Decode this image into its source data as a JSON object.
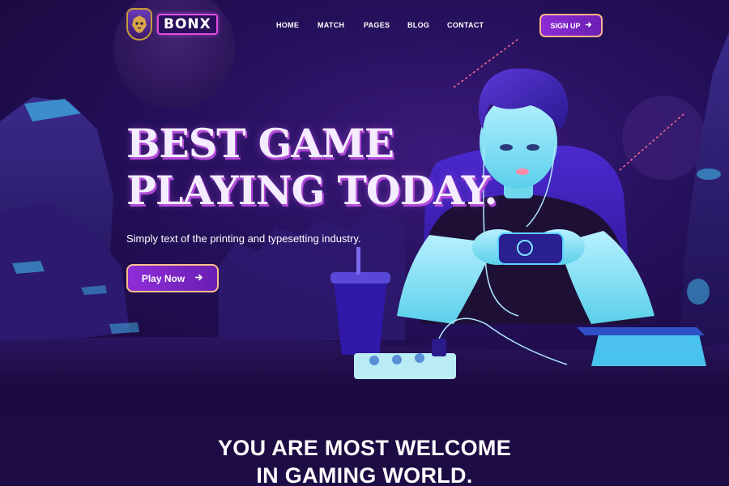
{
  "brand": {
    "name": "BONX",
    "logo_icon": "lion-icon"
  },
  "nav": {
    "items": [
      "HOME",
      "MATCH",
      "PAGES",
      "BLOG",
      "CONTACT"
    ]
  },
  "header": {
    "signup_label": "SIGN UP",
    "signup_icon": "arrow-right-icon"
  },
  "hero": {
    "title_line1": "BEST GAME",
    "title_line2": "PLAYING TODAY.",
    "subtitle": "Simply text of the printing and typesetting industry.",
    "cta_label": "Play Now",
    "cta_icon": "arrow-right-icon"
  },
  "welcome": {
    "line1": "YOU ARE MOST WELCOME",
    "line2": "IN GAMING WORLD."
  },
  "colors": {
    "background": "#1a0a3a",
    "accent_purple": "#8d2cd6",
    "button_border": "#ffb58a",
    "title_shadow": "#b44bd9",
    "glow_cyan": "#4fd6ff"
  }
}
